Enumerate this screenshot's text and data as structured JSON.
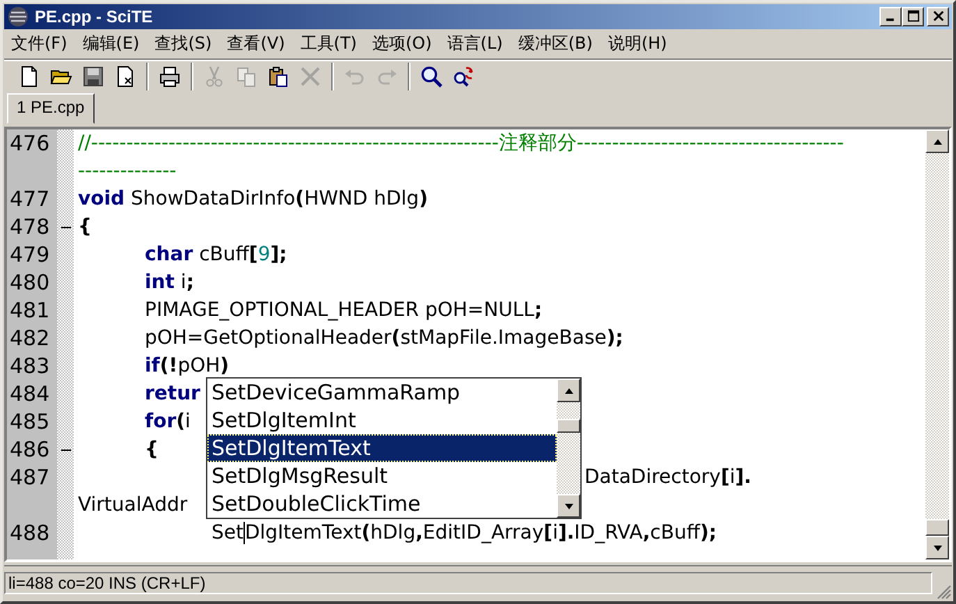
{
  "window": {
    "title": "PE.cpp - SciTE"
  },
  "menu": [
    "文件(F)",
    "编辑(E)",
    "查找(S)",
    "查看(V)",
    "工具(T)",
    "选项(O)",
    "语言(L)",
    "缓冲区(B)",
    "说明(H)"
  ],
  "toolbar": [
    {
      "kind": "new",
      "disabled": false
    },
    {
      "kind": "open",
      "disabled": false
    },
    {
      "kind": "save",
      "disabled": false
    },
    {
      "kind": "close",
      "disabled": false
    },
    {
      "kind": "separator"
    },
    {
      "kind": "print",
      "disabled": false
    },
    {
      "kind": "separator"
    },
    {
      "kind": "cut",
      "disabled": true
    },
    {
      "kind": "copy",
      "disabled": true
    },
    {
      "kind": "paste",
      "disabled": false
    },
    {
      "kind": "delete",
      "disabled": true
    },
    {
      "kind": "separator"
    },
    {
      "kind": "undo",
      "disabled": true
    },
    {
      "kind": "redo",
      "disabled": true
    },
    {
      "kind": "separator"
    },
    {
      "kind": "find",
      "disabled": false
    },
    {
      "kind": "replace",
      "disabled": false
    }
  ],
  "tabs": [
    {
      "label": "1 PE.cpp",
      "selected": true
    }
  ],
  "lines": [
    {
      "number": "476",
      "fold_open": false,
      "rows": [
        {
          "indent": "",
          "tokens": [
            {
              "kind": "comment",
              "text": "//----------------------------------------------------------注释部分--------------------------------------"
            }
          ]
        },
        {
          "indent": "",
          "tokens": [
            {
              "kind": "comment",
              "text": "--------------"
            }
          ]
        }
      ]
    },
    {
      "number": "477",
      "fold_open": false,
      "rows": [
        {
          "indent": "",
          "tokens": [
            {
              "kind": "keyword",
              "text": "void"
            },
            {
              "kind": "identifier",
              "text": " ShowDataDirInfo"
            },
            {
              "kind": "operator",
              "text": "("
            },
            {
              "kind": "identifier",
              "text": "HWND hDlg"
            },
            {
              "kind": "operator",
              "text": ")"
            }
          ]
        }
      ]
    },
    {
      "number": "478",
      "fold_open": true,
      "rows": [
        {
          "indent": "",
          "tokens": [
            {
              "kind": "operator",
              "text": "{"
            }
          ]
        }
      ]
    },
    {
      "number": "479",
      "fold_open": false,
      "rows": [
        {
          "indent": "\t",
          "tokens": [
            {
              "kind": "keyword",
              "text": "char"
            },
            {
              "kind": "identifier",
              "text": " cBuff"
            },
            {
              "kind": "operator",
              "text": "["
            },
            {
              "kind": "number",
              "text": "9"
            },
            {
              "kind": "operator",
              "text": "];"
            }
          ]
        }
      ]
    },
    {
      "number": "480",
      "fold_open": false,
      "rows": [
        {
          "indent": "\t",
          "tokens": [
            {
              "kind": "keyword",
              "text": "int"
            },
            {
              "kind": "identifier",
              "text": " i"
            },
            {
              "kind": "operator",
              "text": ";"
            }
          ]
        }
      ]
    },
    {
      "number": "481",
      "fold_open": false,
      "rows": [
        {
          "indent": "\t",
          "tokens": [
            {
              "kind": "identifier",
              "text": "PIMAGE_OPTIONAL_HEADER pOH=NULL"
            },
            {
              "kind": "operator",
              "text": ";"
            }
          ]
        }
      ]
    },
    {
      "number": "482",
      "fold_open": false,
      "rows": [
        {
          "indent": "\t",
          "tokens": [
            {
              "kind": "identifier",
              "text": "pOH=GetOptionalHeader"
            },
            {
              "kind": "operator",
              "text": "("
            },
            {
              "kind": "identifier",
              "text": "stMapFile.ImageBase"
            },
            {
              "kind": "operator",
              "text": ");"
            }
          ]
        }
      ]
    },
    {
      "number": "483",
      "fold_open": false,
      "rows": [
        {
          "indent": "\t",
          "tokens": [
            {
              "kind": "keyword",
              "text": "if"
            },
            {
              "kind": "operator",
              "text": "(!"
            },
            {
              "kind": "identifier",
              "text": "pOH"
            },
            {
              "kind": "operator",
              "text": ")"
            }
          ]
        }
      ]
    },
    {
      "number": "484",
      "fold_open": false,
      "rows": [
        {
          "indent": "\t",
          "tokens": [
            {
              "kind": "keyword",
              "text": "retur"
            }
          ]
        }
      ]
    },
    {
      "number": "485",
      "fold_open": false,
      "rows": [
        {
          "indent": "\t",
          "tokens": [
            {
              "kind": "keyword",
              "text": "for"
            },
            {
              "kind": "operator",
              "text": "("
            },
            {
              "kind": "identifier",
              "text": "i"
            }
          ]
        }
      ]
    },
    {
      "number": "486",
      "fold_open": true,
      "rows": [
        {
          "indent": "\t",
          "tokens": [
            {
              "kind": "operator",
              "text": "{"
            }
          ]
        }
      ]
    },
    {
      "number": "487",
      "fold_open": false,
      "rows": [
        {
          "indent": "",
          "covered_by_popup": true,
          "tokens": [
            {
              "kind": "identifier",
              "text": "DataDirectory"
            },
            {
              "kind": "operator",
              "text": "["
            },
            {
              "kind": "identifier",
              "text": "i"
            },
            {
              "kind": "operator",
              "text": "]."
            }
          ]
        },
        {
          "indent": "",
          "tokens": [
            {
              "kind": "identifier",
              "text": "VirtualAddr"
            }
          ]
        }
      ]
    },
    {
      "number": "488",
      "fold_open": false,
      "rows": [
        {
          "indent": "\t\t",
          "tokens": [
            {
              "kind": "identifier",
              "text": "Set"
            },
            {
              "kind": "identifier",
              "text": "DlgItemText",
              "caret": true
            },
            {
              "kind": "operator",
              "text": "("
            },
            {
              "kind": "identifier",
              "text": "hDlg"
            },
            {
              "kind": "operator",
              "text": ","
            },
            {
              "kind": "identifier",
              "text": "EditID_Array"
            },
            {
              "kind": "operator",
              "text": "["
            },
            {
              "kind": "identifier",
              "text": "i"
            },
            {
              "kind": "operator",
              "text": "]."
            },
            {
              "kind": "identifier",
              "text": "ID_RVA"
            },
            {
              "kind": "operator",
              "text": ","
            },
            {
              "kind": "identifier",
              "text": "cBuff"
            },
            {
              "kind": "operator",
              "text": ");"
            }
          ]
        }
      ]
    }
  ],
  "autocomplete": [
    {
      "label": "SetDeviceGammaRamp",
      "selected": false
    },
    {
      "label": "SetDlgItemInt",
      "selected": false
    },
    {
      "label": "SetDlgItemText",
      "selected": true
    },
    {
      "label": "SetDlgMsgResult",
      "selected": false
    },
    {
      "label": "SetDoubleClickTime",
      "selected": false
    }
  ],
  "status_bar": {
    "text": "li=488 co=20 INS (CR+LF)"
  }
}
